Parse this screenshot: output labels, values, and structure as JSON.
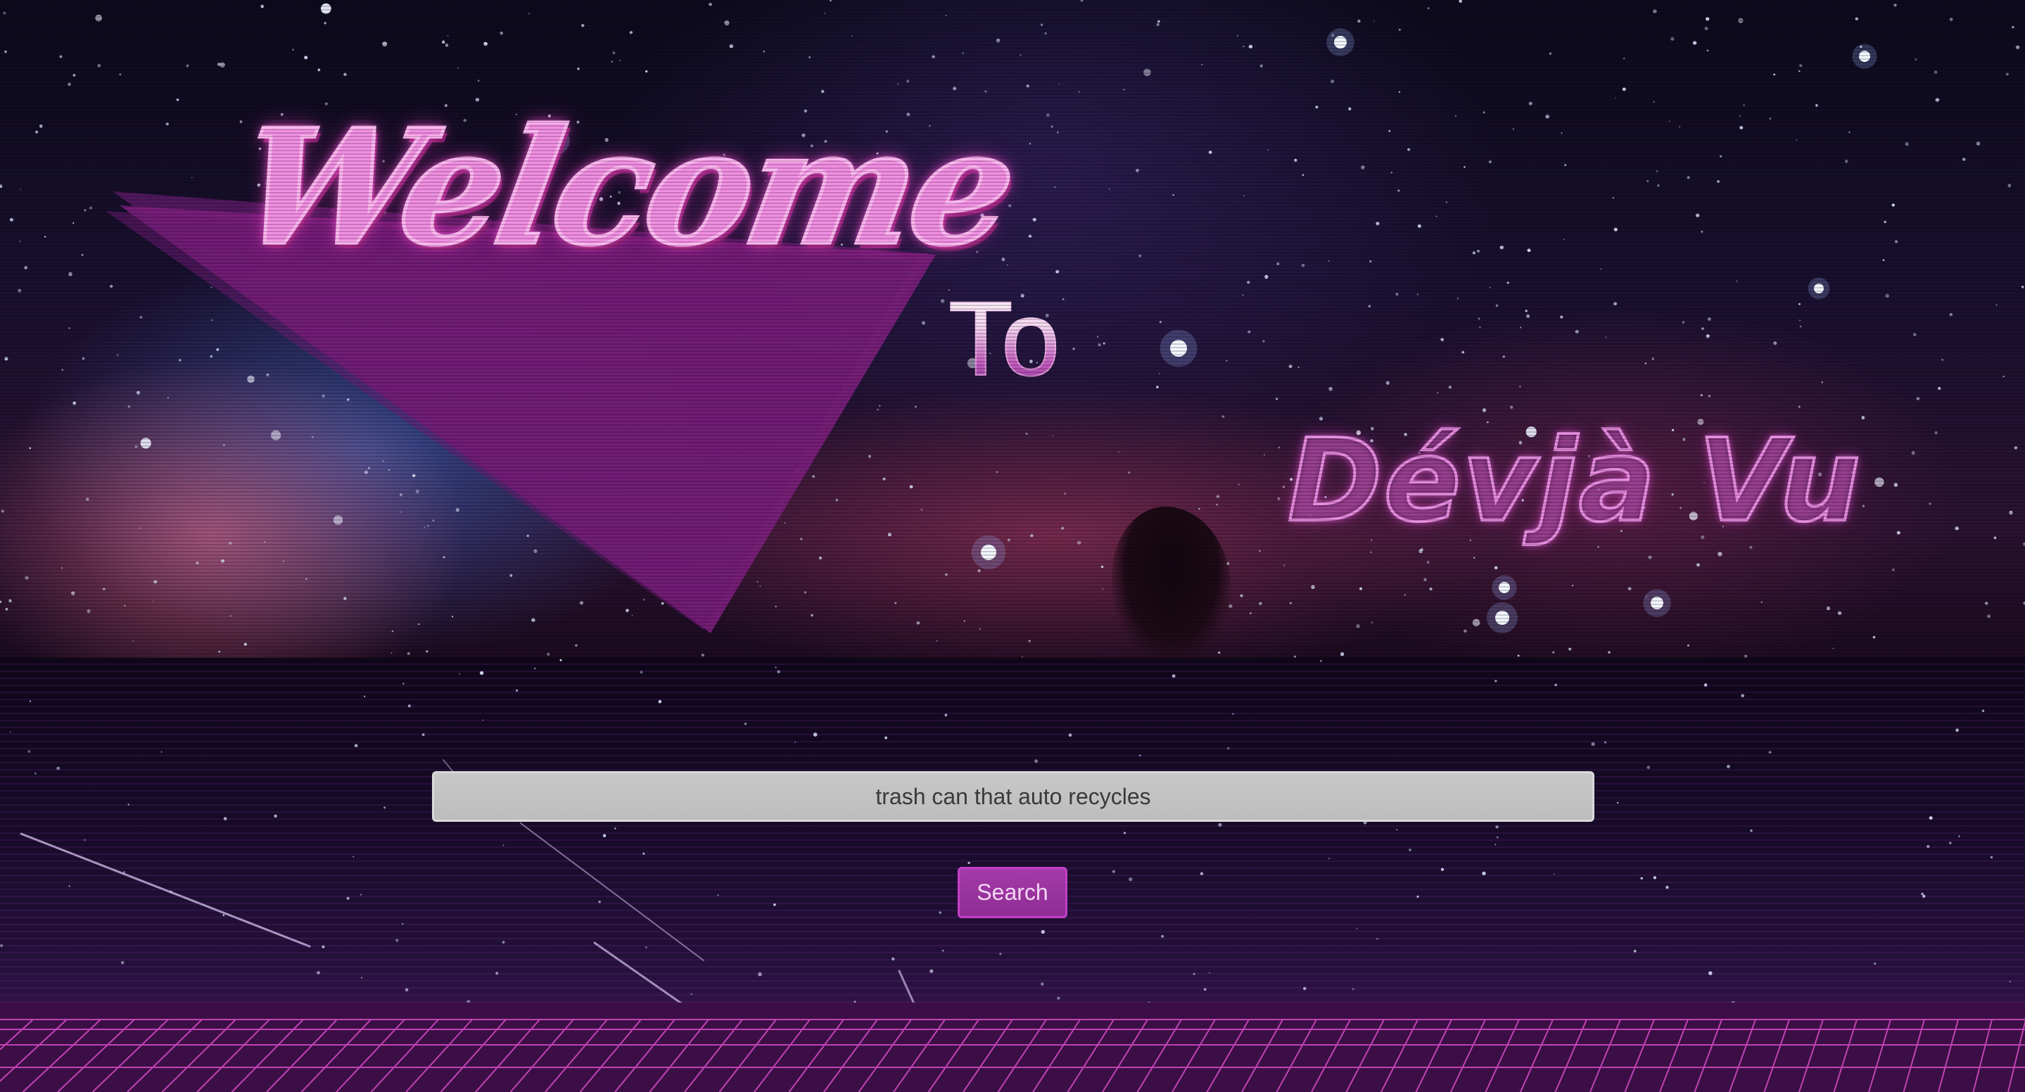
{
  "hero": {
    "welcome": "Welcome",
    "to": "To",
    "brand": "Dévjà Vu"
  },
  "search": {
    "value": "trash can that auto recycles",
    "placeholder": "",
    "button_label": "Search"
  },
  "colors": {
    "neon_pink": "#f28fe3",
    "banner_purple": "#7d1f7e",
    "button_purple": "#9b34a0",
    "grid_pink": "#d94bc8",
    "input_grey": "#c3c3c3"
  },
  "icons": {
    "banner": "triangle-banner",
    "floor": "synthwave-grid"
  }
}
